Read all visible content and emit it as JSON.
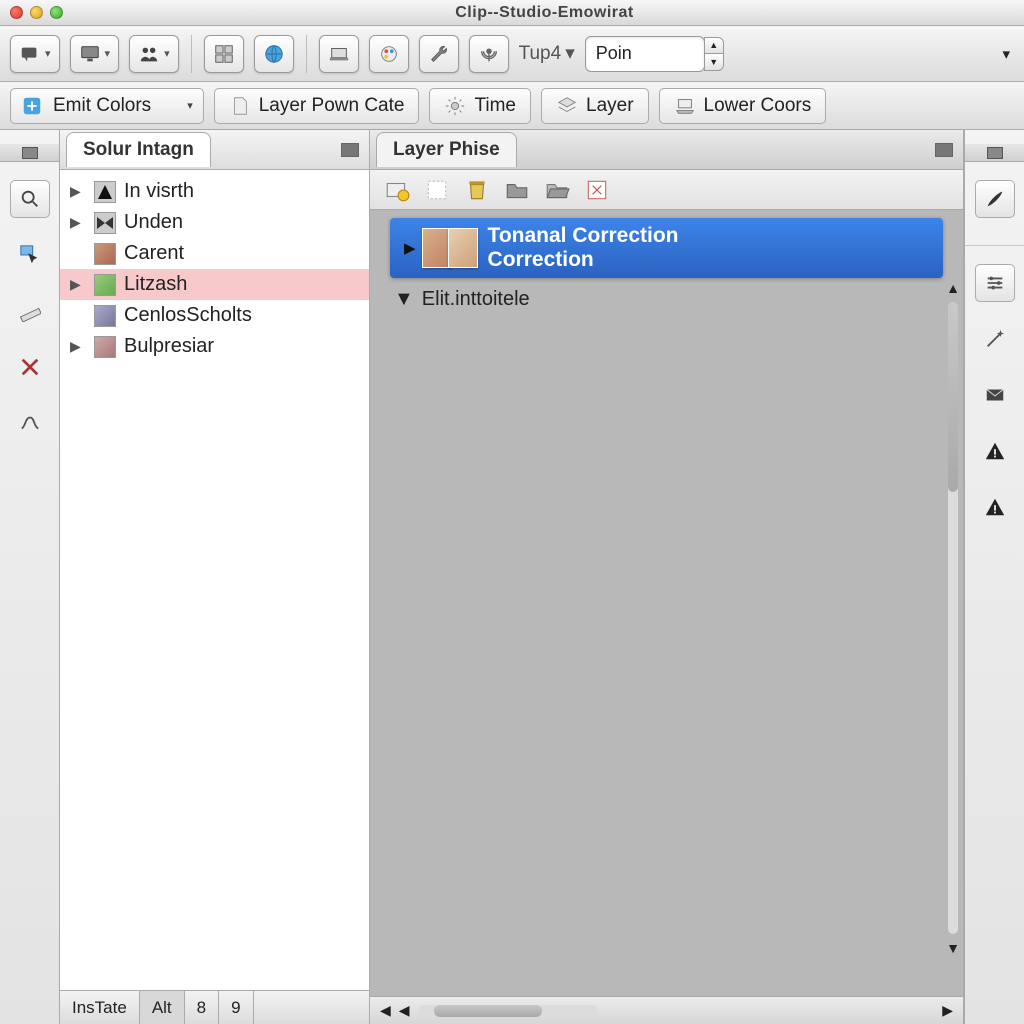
{
  "window": {
    "title": "Clip--Studio-Emowirat"
  },
  "toolbar1": {
    "tup_label": "Tup4",
    "point_field": "Poin"
  },
  "toolbar2": {
    "emit_colors": "Emit Colors",
    "layer_pown": "Layer Pown Cate",
    "time": "Time",
    "layer": "Layer",
    "lower_coors": "Lower Coors"
  },
  "left_panel": {
    "tab": "Solur Intagn",
    "nodes": [
      {
        "label": "In visrth",
        "arrow": true,
        "icon": "triangle"
      },
      {
        "label": "Unden",
        "arrow": true,
        "icon": "bowtie"
      },
      {
        "label": "Carent",
        "arrow": false,
        "icon": "thumb"
      },
      {
        "label": "Litzash",
        "arrow": true,
        "icon": "thumb",
        "selected": true
      },
      {
        "label": "CenlosScholts",
        "arrow": false,
        "icon": "thumb"
      },
      {
        "label": "Bulpresiar",
        "arrow": true,
        "icon": "thumb"
      }
    ],
    "bottom_tabs": [
      "InsTate",
      "Alt",
      "8",
      "9"
    ]
  },
  "main_panel": {
    "tab": "Layer Phise",
    "selected_layer_line1": "Tonanal Correction",
    "selected_layer_line2": "Correction",
    "group_row": "Elit.inttoitele"
  }
}
